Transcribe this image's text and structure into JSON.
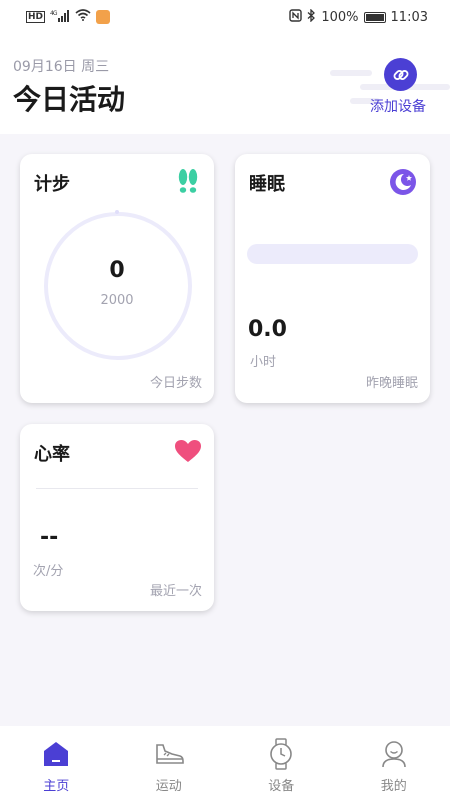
{
  "status_bar": {
    "carrier_badge": "HD",
    "network": "4G",
    "battery_percent": "100%",
    "time": "11:03"
  },
  "header": {
    "date": "09月16日 周三",
    "title": "今日活动",
    "add_device_label": "添加设备",
    "accent_color": "#4b3fd4"
  },
  "cards": {
    "steps": {
      "title": "计步",
      "value": "0",
      "goal": "2000",
      "footer": "今日步数",
      "progress_fraction": 0
    },
    "sleep": {
      "title": "睡眠",
      "value": "0.0",
      "unit": "小时",
      "footer": "昨晚睡眠"
    },
    "heart_rate": {
      "title": "心率",
      "value": "--",
      "unit": "次/分",
      "footer": "最近一次"
    }
  },
  "bottom_nav": {
    "items": [
      {
        "label": "主页",
        "icon": "home-icon",
        "active": true
      },
      {
        "label": "运动",
        "icon": "sneaker-icon",
        "active": false
      },
      {
        "label": "设备",
        "icon": "watch-icon",
        "active": false
      },
      {
        "label": "我的",
        "icon": "user-icon",
        "active": false
      }
    ]
  }
}
